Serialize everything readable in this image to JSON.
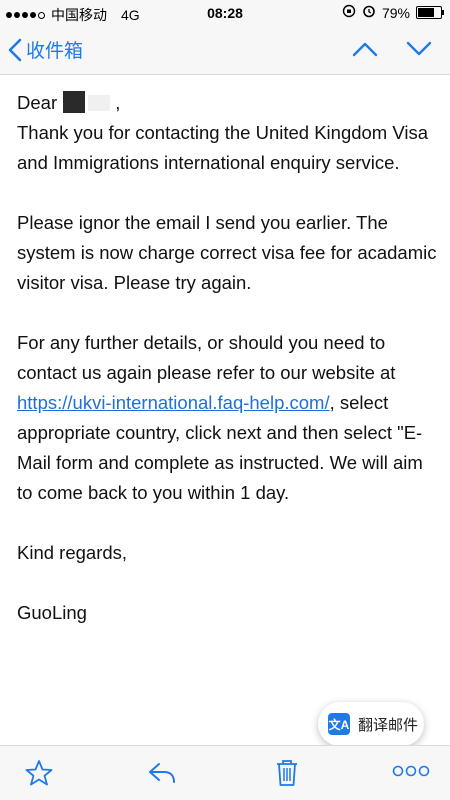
{
  "status_bar": {
    "carrier": "中国移动",
    "network": "4G",
    "time": "08:28",
    "battery": "79%",
    "battery_level": 0.79
  },
  "nav": {
    "back_label": "收件箱"
  },
  "email": {
    "greeting_prefix": "Dear",
    "greeting_suffix": ",",
    "para1": "Thank you for contacting the United Kingdom Visa and Immigrations international enquiry service.",
    "para2": "Please ignor the email I send you earlier. The system is now charge correct visa fee for acadamic visitor visa. Please try again.",
    "para3_before": "For any further details, or should you need to contact us again please refer to our website at ",
    "para3_link": "https://ukvi-international.faq-help.com/",
    "para3_after": ", select appropriate country, click next and then select \"E-Mail form and complete as instructed. We will aim to come back to you within 1 day.",
    "closing": "Kind regards,",
    "signature": "GuoLing"
  },
  "translate": {
    "icon_text": "文A",
    "label": "翻译邮件"
  },
  "colors": {
    "accent": "#1f7ae8",
    "link": "#1f6fd8"
  }
}
